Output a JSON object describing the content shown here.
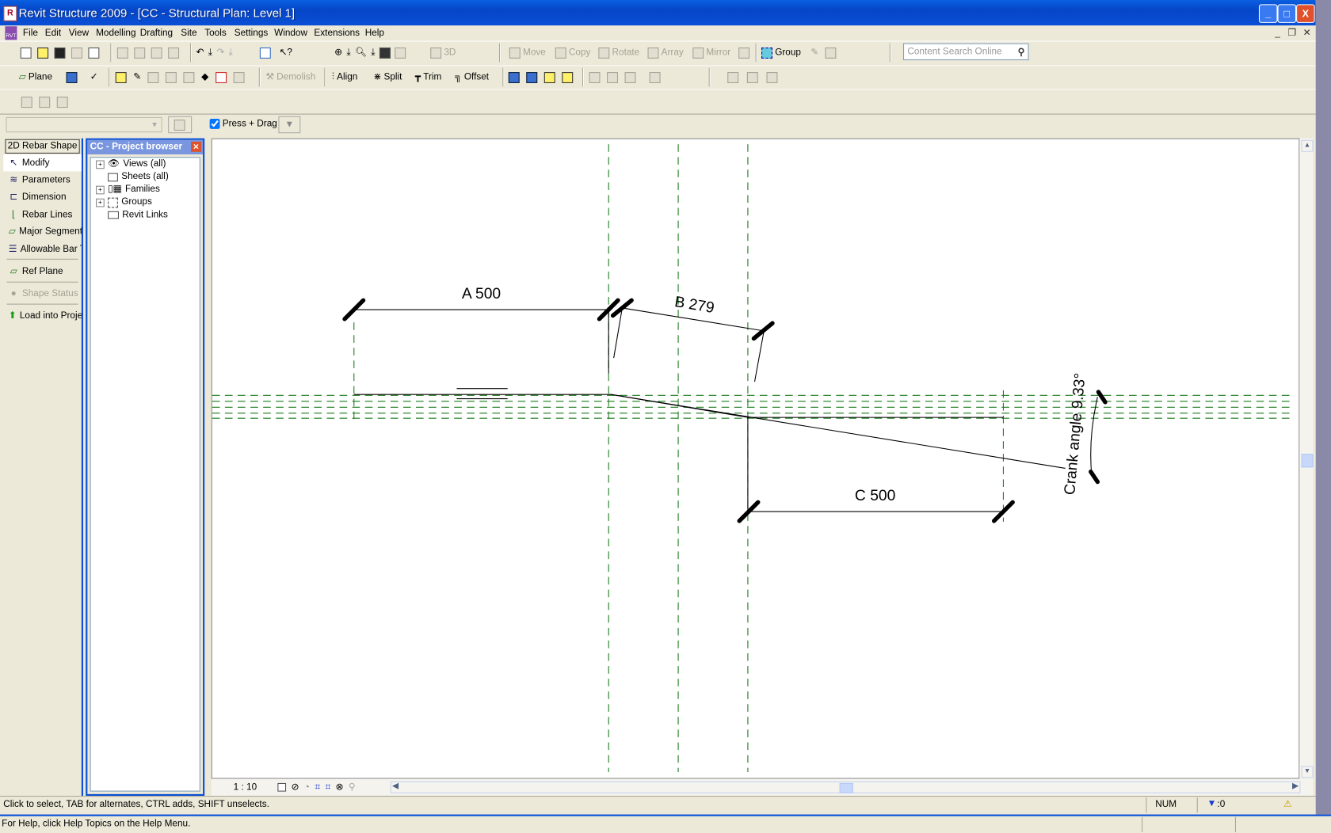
{
  "window": {
    "title": "Revit Structure 2009 - [CC - Structural Plan: Level 1]",
    "app_icon": "RS"
  },
  "menu": [
    "File",
    "Edit",
    "View",
    "Modelling",
    "Drafting",
    "Site",
    "Tools",
    "Settings",
    "Window",
    "Extensions",
    "Help"
  ],
  "toolbar1": {
    "move": "Move",
    "copy": "Copy",
    "rotate": "Rotate",
    "array": "Array",
    "mirror": "Mirror",
    "three_d": "3D",
    "group": "Group",
    "search_placeholder": "Content Search Online"
  },
  "toolbar2": {
    "plane": "Plane",
    "demolish": "Demolish",
    "align": "Align",
    "split": "Split",
    "trim": "Trim",
    "offset": "Offset"
  },
  "options": {
    "press_drag": "Press + Drag",
    "press_drag_checked": true
  },
  "design_bar": {
    "tab": "2D Rebar Shape",
    "items": [
      "Modify",
      "Parameters",
      "Dimension",
      "Rebar Lines",
      "Major Segment",
      "Allowable Bar T",
      "Ref Plane",
      "Shape Status",
      "Load into Proje"
    ]
  },
  "project_browser": {
    "title": "CC - Project browser",
    "nodes": [
      "Views (all)",
      "Sheets (all)",
      "Families",
      "Groups",
      "Revit Links"
    ]
  },
  "drawing": {
    "dim_a": "A 500",
    "dim_b": "B 279",
    "dim_c": "C 500",
    "crank": "Crank angle 9.33°",
    "ref_color": "#1a7a1a"
  },
  "view_control": {
    "scale": "1 : 10"
  },
  "status": {
    "message": "Click to select, TAB for alternates, CTRL adds, SHIFT unselects.",
    "num": "NUM",
    "filter": ":0"
  },
  "help": "For Help, click Help Topics on the Help Menu."
}
